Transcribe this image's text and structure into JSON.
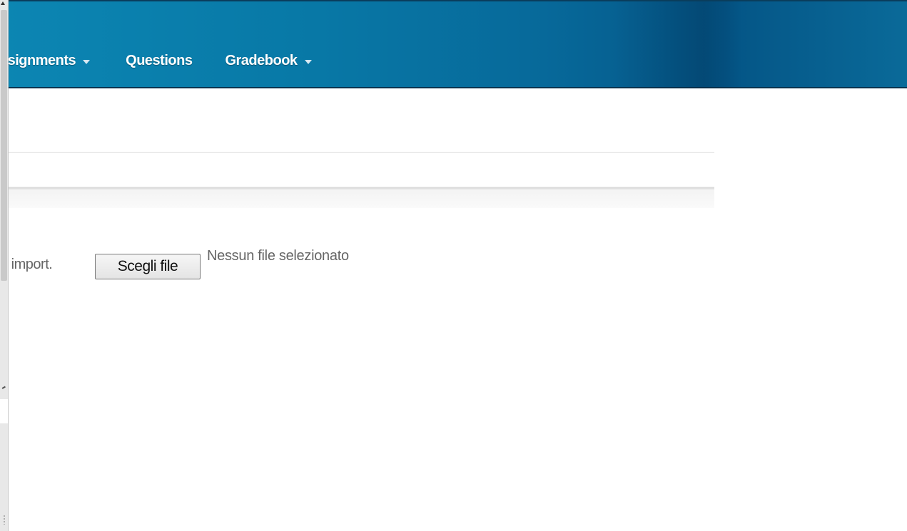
{
  "navbar": {
    "items": [
      {
        "label": "ssignments",
        "has_dropdown": true
      },
      {
        "label": "Questions",
        "has_dropdown": false
      },
      {
        "label": "Gradebook",
        "has_dropdown": true
      }
    ],
    "background_color": "#07699a"
  },
  "import": {
    "label": "o import.",
    "button_label": "Scegli file",
    "status_text": "Nessun file selezionato"
  },
  "icons": [
    "chevron-down-icon",
    "scroll-up-arrow-icon",
    "resize-grip-icon"
  ]
}
